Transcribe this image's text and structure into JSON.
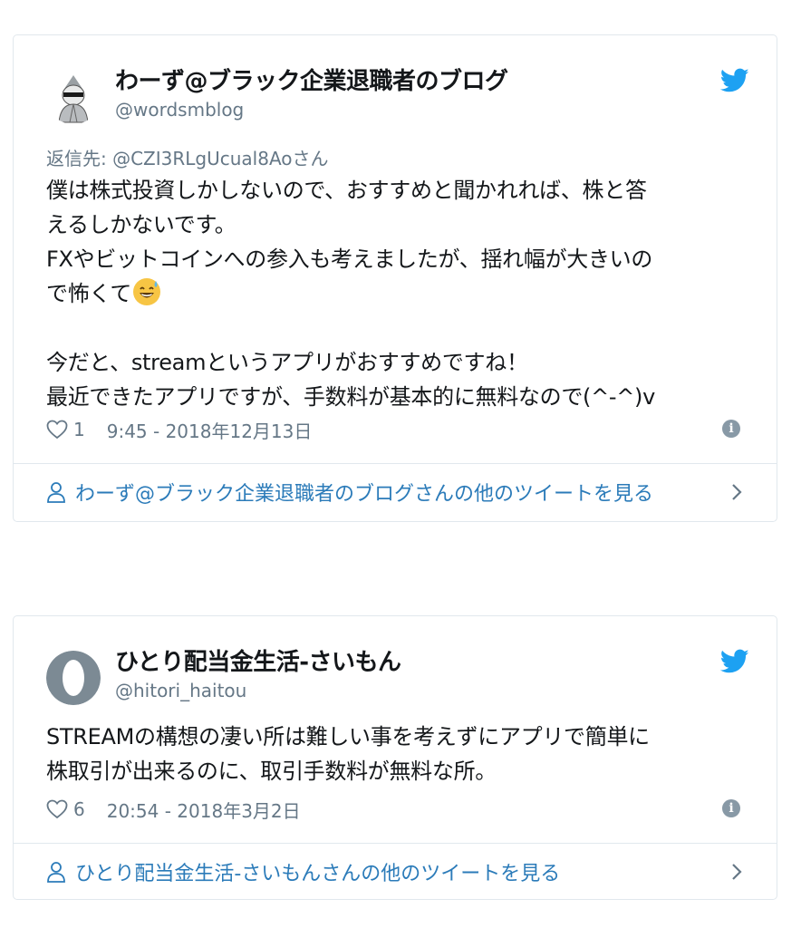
{
  "tweets": [
    {
      "name": "わーず@ブラック企業退職者のブログ",
      "handle": "@wordsmblog",
      "reply_to": "返信先: @CZI3RLgUcual8Aoさん",
      "lines": [
        "僕は株式投資しかしないので、おすすめと聞かれれば、株と答",
        "えるしかないです。",
        "FXやビットコインへの参入も考えましたが、揺れ幅が大きいの",
        "で怖くて",
        "",
        "今だと、streamというアプリがおすすめですね！",
        "最近できたアプリですが、手数料が基本的に無料なので(^-^)v"
      ],
      "likes": "1",
      "timestamp": "9:45 - 2018年12月13日",
      "more_link": "わーず@ブラック企業退職者のブログさんの他のツイートを見る"
    },
    {
      "name": "ひとり配当金生活-さいもん",
      "handle": "@hitori_haitou",
      "lines": [
        "STREAMの構想の凄い所は難しい事を考えずにアプリで簡単に",
        "株取引が出来るのに、取引手数料が無料な所。"
      ],
      "likes": "6",
      "timestamp": "20:54 - 2018年3月2日",
      "more_link": "ひとり配当金生活-さいもんさんの他のツイートを見る"
    }
  ],
  "colors": {
    "twitter_blue": "#1da1f2",
    "link_blue": "#2b7bb9",
    "muted_gray": "#657786",
    "border": "#e1e8ed"
  },
  "icons": [
    "twitter-bird-icon",
    "heart-icon",
    "info-icon",
    "person-icon",
    "chevron-right-icon",
    "sweat-smile-emoji"
  ]
}
